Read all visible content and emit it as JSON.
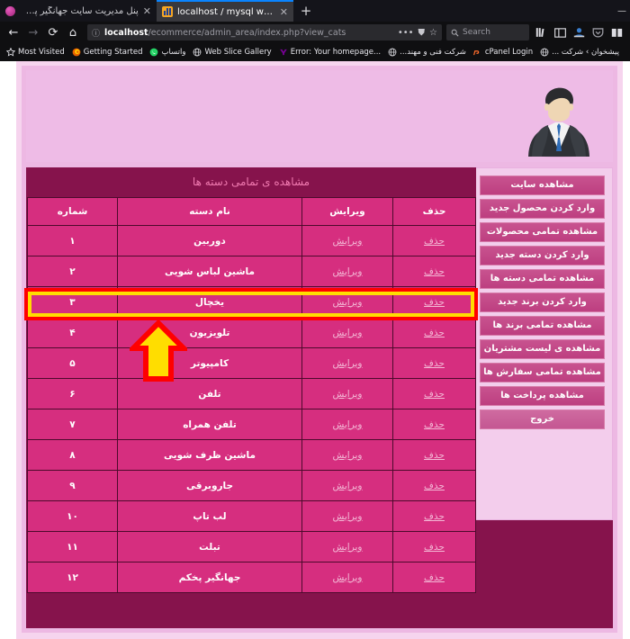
{
  "browser": {
    "tabs": [
      {
        "title": "پنل مدیریت سایت جهانگیر پخکم",
        "active": false
      },
      {
        "title": "localhost / mysql wampserver / ec",
        "active": true
      }
    ],
    "new_tab_label": "+",
    "nav": {
      "back_icon": "←",
      "forward_icon": "→",
      "reload_icon": "⟳",
      "home_icon": "⌂",
      "info_icon": "ⓘ",
      "menu_icon": "•••",
      "shield_icon": "⛊",
      "star_icon": "☆"
    },
    "url": {
      "host": "localhost",
      "path": "/ecommerce/admin_area/index.php?view_cats"
    },
    "search": {
      "placeholder": "Search",
      "icon": "search-icon"
    },
    "toolbar_icons": [
      "library-icon",
      "sidebar-icon",
      "account-icon",
      "pocket-icon",
      "reader-icon"
    ],
    "bookmarks": [
      {
        "label": "Most Visited",
        "icon": "star-outline-icon",
        "rtl": false
      },
      {
        "label": "Getting Started",
        "icon": "firefox-icon",
        "rtl": false
      },
      {
        "label": "واتساپ",
        "icon": "whatsapp-icon",
        "rtl": true
      },
      {
        "label": "Web Slice Gallery",
        "icon": "globe-icon",
        "rtl": false
      },
      {
        "label": "Error: Your homepage...",
        "icon": "yahoo-icon",
        "rtl": false
      },
      {
        "label": "شرکت فنی و مهند...",
        "icon": "globe-icon",
        "rtl": true
      },
      {
        "label": "cPanel Login",
        "icon": "cpanel-icon",
        "rtl": false
      },
      {
        "label": "پیشخوان › شرکت ...",
        "icon": "globe-icon",
        "rtl": true
      }
    ],
    "window_controls": [
      "minimize",
      "maximize",
      "close"
    ]
  },
  "page": {
    "header": {
      "avatar_icon": "businessman-avatar-icon"
    },
    "sidebar": {
      "items": [
        "مشاهده سایت",
        "وارد کردن محصول جدید",
        "مشاهده تمامی محصولات",
        "وارد کردن دسته جدید",
        "مشاهده تمامی دسته ها",
        "وارد کردن برند جدید",
        "مشاهده تمامی برند ها",
        "مشاهده ی لیست مشتریان",
        "مشاهده تمامی سفارش ها",
        "مشاهده پرداخت ها",
        "خروج"
      ]
    },
    "table": {
      "title": "مشاهده ی تمامی دسته ها",
      "headers": [
        "حذف",
        "ویرایش",
        "نام دسته",
        "شماره"
      ],
      "action_delete": "حذف",
      "action_edit": "ویرایش",
      "rows": [
        {
          "num": "۱",
          "name": "دوربین",
          "edit": "ویرایش",
          "delete": "حذف",
          "highlighted": true
        },
        {
          "num": "۲",
          "name": "ماشین لباس شویی",
          "edit": "ویرایش",
          "delete": "حذف",
          "highlighted": false
        },
        {
          "num": "۳",
          "name": "یخچال",
          "edit": "ویرایش",
          "delete": "حذف",
          "highlighted": false
        },
        {
          "num": "۴",
          "name": "تلویزیون",
          "edit": "ویرایش",
          "delete": "حذف",
          "highlighted": false
        },
        {
          "num": "۵",
          "name": "کامپیوتر",
          "edit": "ویرایش",
          "delete": "حذف",
          "highlighted": false
        },
        {
          "num": "۶",
          "name": "تلفن",
          "edit": "ویرایش",
          "delete": "حذف",
          "highlighted": false
        },
        {
          "num": "۷",
          "name": "تلفن همراه",
          "edit": "ویرایش",
          "delete": "حذف",
          "highlighted": false
        },
        {
          "num": "۸",
          "name": "ماشین ظرف شویی",
          "edit": "ویرایش",
          "delete": "حذف",
          "highlighted": false
        },
        {
          "num": "۹",
          "name": "جاروبرقی",
          "edit": "ویرایش",
          "delete": "حذف",
          "highlighted": false
        },
        {
          "num": "۱۰",
          "name": "لب تاپ",
          "edit": "ویرایش",
          "delete": "حذف",
          "highlighted": false
        },
        {
          "num": "۱۱",
          "name": "تبلت",
          "edit": "ویرایش",
          "delete": "حذف",
          "highlighted": false
        },
        {
          "num": "۱۲",
          "name": "جهانگیر پخکم",
          "edit": "ویرایش",
          "delete": "حذف",
          "highlighted": false
        }
      ]
    }
  },
  "annotations": {
    "highlight_color": "#ffdd00",
    "highlight_outline_color": "#ff0000",
    "arrow_icon": "up-arrow-annotation-icon"
  },
  "colors": {
    "page_bg": "#f6d4ee",
    "wrapper_bg": "#edb8e3",
    "banner_bg": "#eebbe6",
    "content_bg": "#86134c",
    "table_cell_bg": "#d62e7f",
    "sidebar_bg": "#f3cdec",
    "sidebar_btn": "#c4478a",
    "title_text": "#f07ab0",
    "link_text": "#f3b9d6"
  }
}
